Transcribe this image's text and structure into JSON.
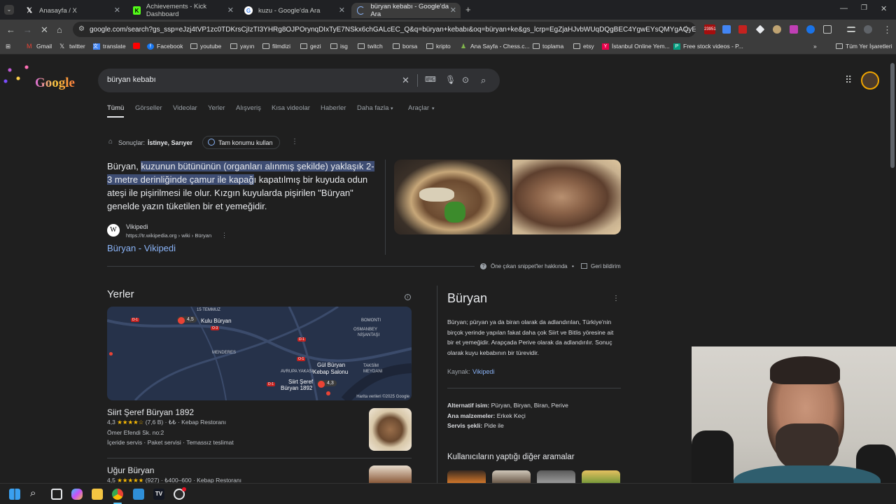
{
  "tabs": [
    {
      "label": "Anasayfa / X",
      "icon": "x-logo-icon"
    },
    {
      "label": "Achievements - Kick Dashboard",
      "icon": "kick-logo-icon"
    },
    {
      "label": "kuzu - Google'da Ara",
      "icon": "google-logo-icon"
    },
    {
      "label": "büryan kebabı - Google'da Ara",
      "icon": "loading-spinner-icon"
    }
  ],
  "address": "google.com/search?gs_ssp=eJzj4tVP1zc0TDKrsCjIzTI3YHRg8OJPOrynqDIxTyE7NSkx6chGALcEC_Q&q=büryan+kebabı&oq=büryan+ke&gs_lcrp=EgZjaHJvbWUqDQgBEC4YgwEYsQMYgAQyEAgAEAAYgwE...",
  "extensions_badge": "23951",
  "bookmarks": [
    {
      "label": "Gmail"
    },
    {
      "label": "twitter"
    },
    {
      "label": "translate"
    },
    {
      "label": ""
    },
    {
      "label": "Facebook"
    },
    {
      "label": "youtube"
    },
    {
      "label": "yayın"
    },
    {
      "label": "filmdizi"
    },
    {
      "label": "gezi"
    },
    {
      "label": "isg"
    },
    {
      "label": "twitch"
    },
    {
      "label": "borsa"
    },
    {
      "label": "kripto"
    },
    {
      "label": "Ana Sayfa - Chess.c..."
    },
    {
      "label": "toplama"
    },
    {
      "label": "etsy"
    },
    {
      "label": "İstanbul Online Yem..."
    },
    {
      "label": "Free stock videos - P..."
    }
  ],
  "all_bookmarks": "Tüm Yer İşaretleri",
  "search": {
    "query": "büryan kebabı"
  },
  "filters": [
    "Tümü",
    "Görseller",
    "Videolar",
    "Yerler",
    "Alışveriş",
    "Kısa videolar",
    "Haberler",
    "Daha fazla",
    "Araçlar"
  ],
  "location": {
    "label": "Sonuçlar:",
    "place": "İstinye, Sarıyer",
    "button": "Tam konumu kullan"
  },
  "snippet": {
    "pre": "Büryan, ",
    "highlight1": "kuzunun bütününün (organları alınmış şekilde) yaklaşık 2-3 metre derinliğinde çamur ile kapağ",
    "post1": "ı kapatılmış bir kuyuda odun ateşi ile pişirilmesi",
    "post2": " ile olur. Kızgın kuyularda pişirilen \"Büryan\" genelde yazın tüketilen bir et yemeğidir.",
    "source_name": "Vikipedi",
    "source_url": "https://tr.wikipedia.org › wiki › Büryan",
    "link": "Büryan - Vikipedi",
    "about": "Öne çıkan snippet'ler hakkında",
    "feedback": "Geri bildirim"
  },
  "places_title": "Yerler",
  "map": {
    "labels": [
      "15 TEMMUZ",
      "Kulu Büryan",
      "BOMONTI",
      "OSMANBEY",
      "NİŞANTAŞI",
      "MENDERES",
      "Gül Büryan",
      "Kebap Salonu",
      "TAKSİM",
      "MEYDANI",
      "AVRUPA YAKASI",
      "Siirt Şeref",
      "Büryan 1892"
    ],
    "ratings": [
      "4,5",
      "4,3"
    ],
    "roads": [
      "D-1",
      "O-3",
      "D-1",
      "O-1",
      "D-1"
    ],
    "credit": "Harita verileri ©2025 Google"
  },
  "places": [
    {
      "name": "Siirt Şeref Büryan 1892",
      "rating": "4,3",
      "stars": "★★★★☆",
      "count": "(7,6 B)",
      "price": "₺₺",
      "type": "Kebap Restoranı",
      "address": "Ömer Efendi Sk. no:2",
      "services": "İçeride servis · Paket servisi · Temassız teslimat"
    },
    {
      "name": "Uğur Büryan",
      "rating": "4,5",
      "stars": "★★★★★",
      "count": "(927)",
      "price": "₺400–600",
      "type": "Kebap Restoranı"
    }
  ],
  "panel": {
    "title": "Büryan",
    "desc": "Büryan; püryan ya da biran olarak da adlandırılan, Türkiye'nin birçok yerinde yapılan fakat daha çok Siirt ve Bitlis yöresine ait bir et yemeğidir. Arapçada Perive olarak da adlandırılır. Sonuç olarak kuyu kebabının bir türevidir.",
    "source_label": "Kaynak:",
    "source": "Vikipedi",
    "facts": [
      {
        "k": "Alternatif isim:",
        "v": "Püryan, Biryan, Biran, Perive"
      },
      {
        "k": "Ana malzemeler:",
        "v": "Erkek Keçi"
      },
      {
        "k": "Servis şekli:",
        "v": "Pide ile"
      }
    ],
    "others": "Kullanıcıların yaptığı diğer aramalar"
  },
  "colors": {
    "highlight": "#3e4d73",
    "link": "#8ab4f8",
    "star": "#fbbc04",
    "pin": "#ea4335"
  }
}
